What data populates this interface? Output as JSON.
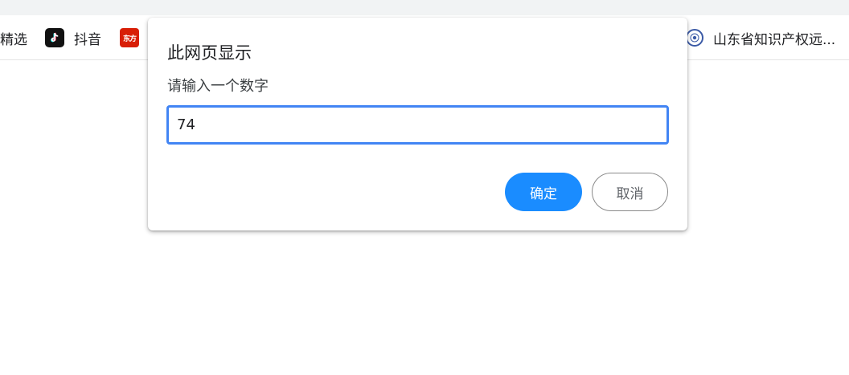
{
  "bookmarks": [
    {
      "label": "精选",
      "icon": "none"
    },
    {
      "label": "抖音",
      "icon": "tiktok-icon"
    },
    {
      "label": "",
      "icon": "dongfang-icon",
      "icon_text": "东方"
    },
    {
      "label": "山东省知识产权远...",
      "icon": "seal-icon"
    }
  ],
  "dialog": {
    "title": "此网页显示",
    "message": "请输入一个数字",
    "input_value": "74",
    "ok_label": "确定",
    "cancel_label": "取消"
  },
  "colors": {
    "accent": "#1a8cff",
    "input_focus": "#4285f4",
    "tiktok_bg": "#111111",
    "dongfang_red": "#d81e06"
  }
}
